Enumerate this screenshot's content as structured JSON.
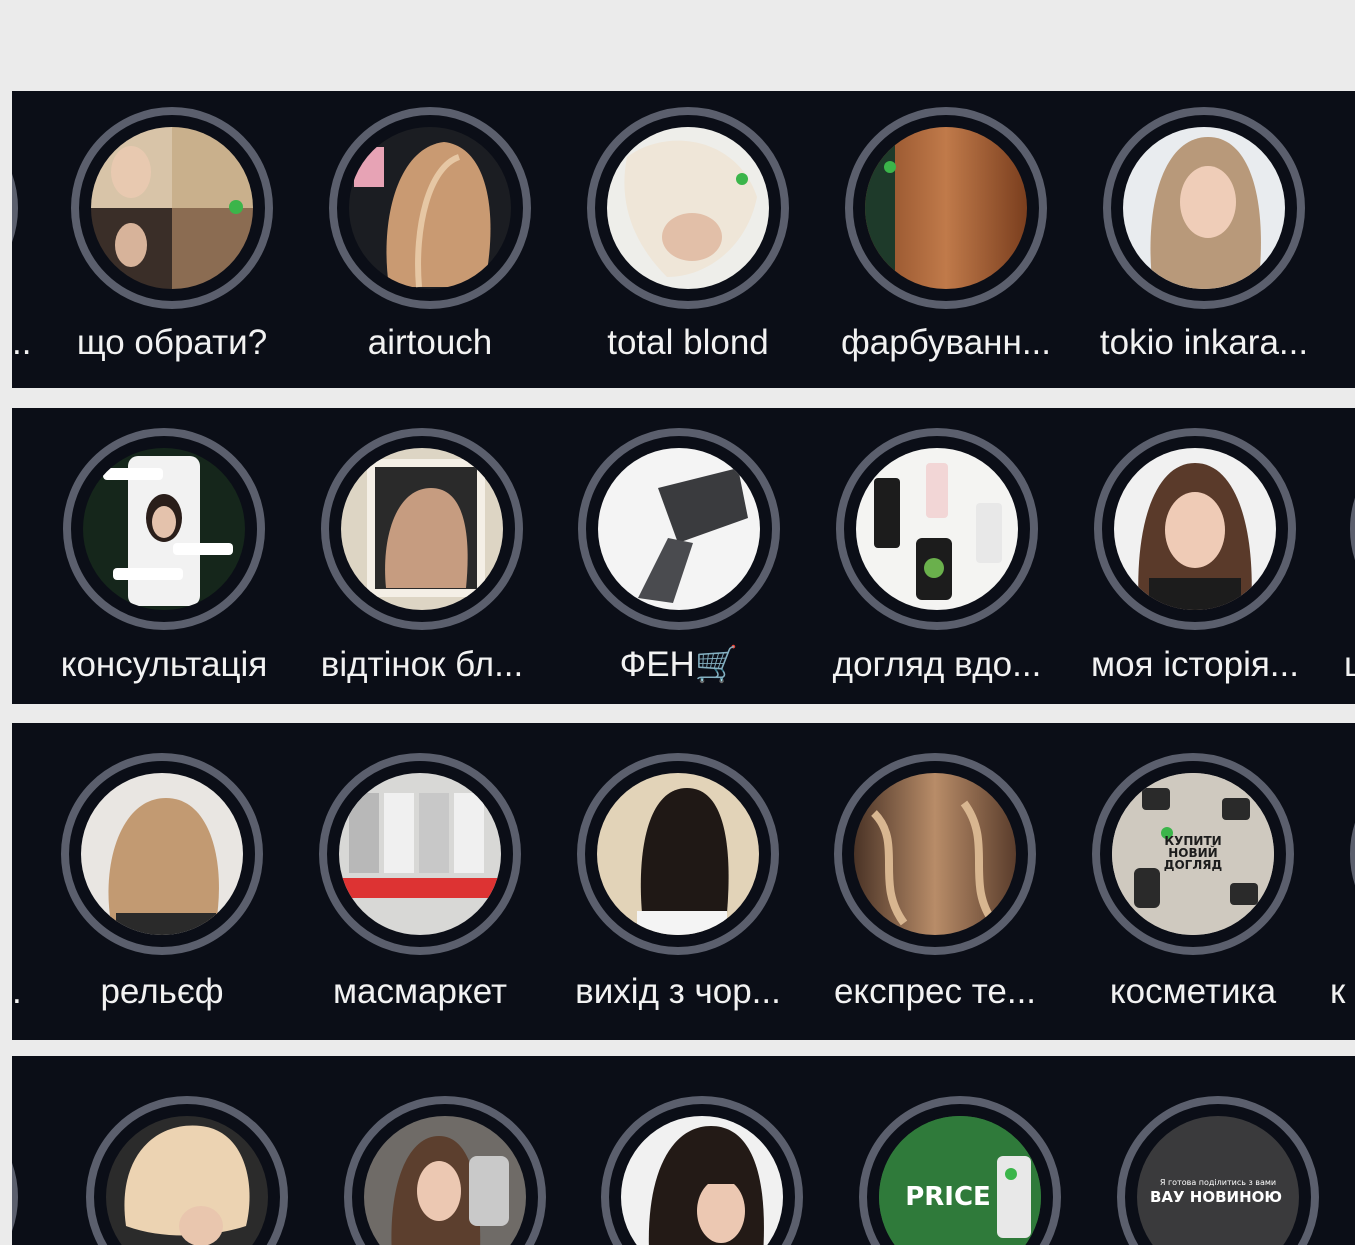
{
  "rows": [
    {
      "left_edge_label": "..",
      "items": [
        {
          "label": "що обрати?",
          "thumb": "hair collage"
        },
        {
          "label": "airtouch",
          "thumb": "blond bob"
        },
        {
          "label": "total blond",
          "thumb": "platinum blond"
        },
        {
          "label": "фарбуванн...",
          "thumb": "copper hair"
        },
        {
          "label": "tokio inkara...",
          "thumb": "long beige hair"
        }
      ]
    },
    {
      "items": [
        {
          "label": "консультація",
          "thumb": "phone chat"
        },
        {
          "label": "відтінок бл...",
          "thumb": "blond bob polaroid"
        },
        {
          "label": "ФЕН🛒",
          "thumb": "hair dryer"
        },
        {
          "label": "догляд вдо...",
          "thumb": "products"
        },
        {
          "label": "моя історія...",
          "thumb": "portrait"
        }
      ],
      "right_edge_label": "ц"
    },
    {
      "left_edge_label": ".",
      "items": [
        {
          "label": "рельєф",
          "thumb": "wavy blond"
        },
        {
          "label": "масмаркет",
          "thumb": "store shelf"
        },
        {
          "label": "вихід з чор...",
          "thumb": "dark bob"
        },
        {
          "label": "експрес те...",
          "thumb": "balayage waves"
        },
        {
          "label": "косметика",
          "thumb": "cosmetics",
          "text": "КУПИТИ НОВИЙ ДОГЛЯД"
        }
      ],
      "right_edge_label": "к"
    },
    {
      "items": [
        {
          "thumb": "blond bob"
        },
        {
          "thumb": "selfie"
        },
        {
          "thumb": "dark hair bangs"
        },
        {
          "thumb": "price",
          "text": "PRICE"
        },
        {
          "thumb": "announcement",
          "small_text": "Я готова поділитись з вами",
          "text": "ВАУ НОВИНОЮ"
        }
      ]
    }
  ]
}
